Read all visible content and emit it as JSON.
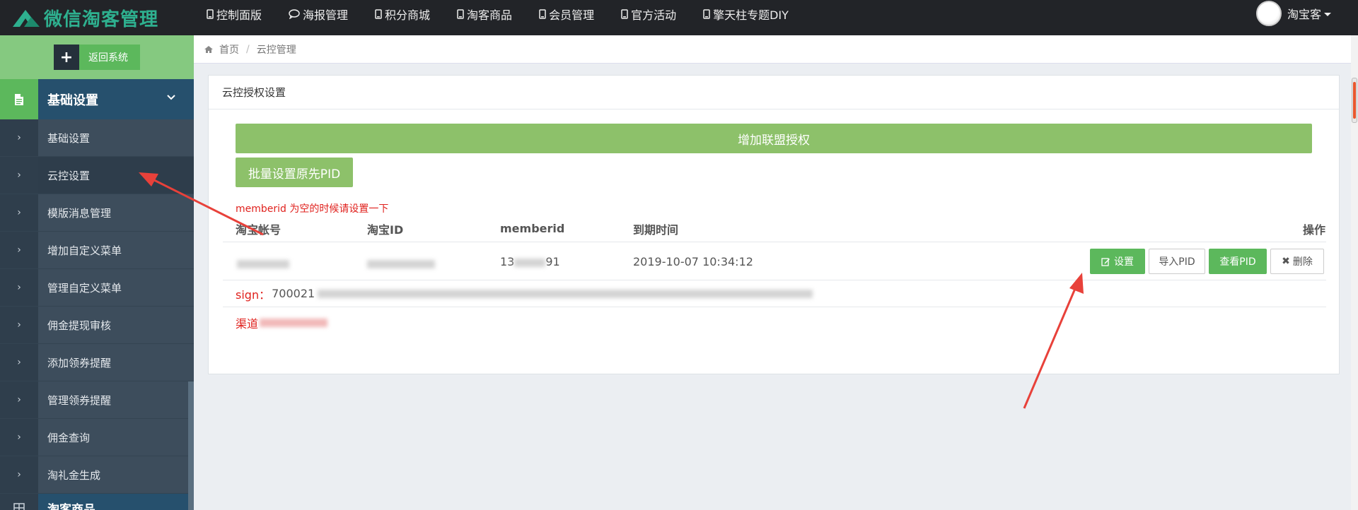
{
  "app": {
    "title": "微信淘客管理"
  },
  "nav": {
    "items": [
      {
        "label": "控制面版",
        "icon": "mobile-icon"
      },
      {
        "label": "海报管理",
        "icon": "comment-icon"
      },
      {
        "label": "积分商城",
        "icon": "mobile-icon"
      },
      {
        "label": "淘客商品",
        "icon": "mobile-icon"
      },
      {
        "label": "会员管理",
        "icon": "mobile-icon"
      },
      {
        "label": "官方活动",
        "icon": "mobile-icon"
      },
      {
        "label": "擎天柱专题DIY",
        "icon": "mobile-icon"
      }
    ]
  },
  "user": {
    "name": "淘宝客"
  },
  "sidebar": {
    "back_label": "返回系统",
    "section_title": "基础设置",
    "items": [
      {
        "label": "基础设置"
      },
      {
        "label": "云控设置"
      },
      {
        "label": "模版消息管理"
      },
      {
        "label": "增加自定义菜单"
      },
      {
        "label": "管理自定义菜单"
      },
      {
        "label": "佣金提现审核"
      },
      {
        "label": "添加领券提醒"
      },
      {
        "label": "管理领券提醒"
      },
      {
        "label": "佣金查询"
      },
      {
        "label": "淘礼金生成"
      }
    ],
    "next_section_title": "淘客商品"
  },
  "breadcrumb": {
    "home": "首页",
    "current": "云控管理"
  },
  "panel": {
    "title": "云控授权设置",
    "add_button": "增加联盟授权",
    "batch_button": "批量设置原先PID",
    "warning": "memberid 为空的时候请设置一下",
    "columns": {
      "account": "淘宝帐号",
      "taobao_id": "淘宝ID",
      "memberid": "memberid",
      "expire": "到期时间",
      "actions": "操作"
    },
    "row": {
      "account": "",
      "taobao_id": "",
      "memberid": "13",
      "memberid_tail": "91",
      "expire": "2019-10-07 10:34:12"
    },
    "actions": {
      "settings": "设置",
      "import_pid": "导入PID",
      "view_pid": "查看PID",
      "delete": "删除"
    },
    "sign_label": "sign：",
    "sign_value": "700021",
    "channel_label": "渠道"
  },
  "colors": {
    "topbar": "#222428",
    "logo": "#2eb08f",
    "sidebar": "#3d4d5c",
    "accent_green": "#5cb85c",
    "button_green": "#8dc16a",
    "warning_red": "#e0211d",
    "annotation_red": "#e8413a"
  }
}
